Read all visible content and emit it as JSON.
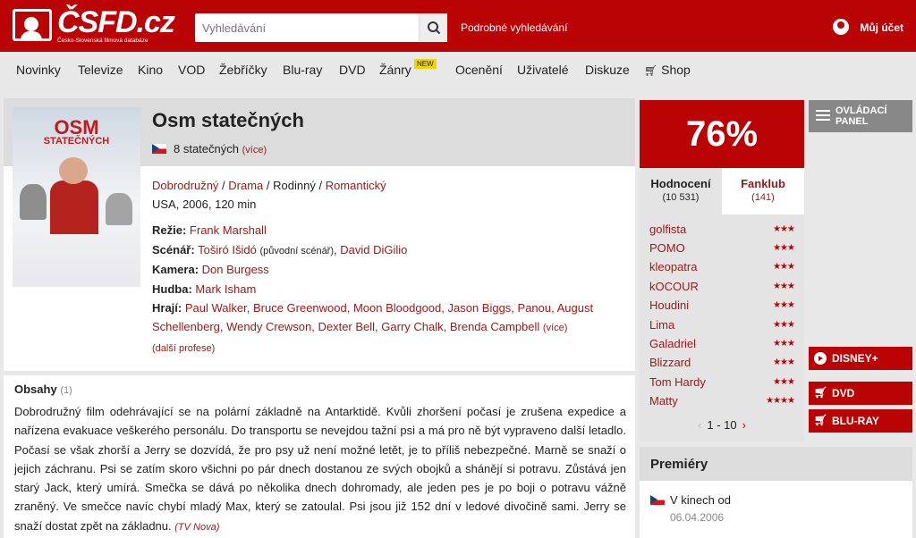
{
  "header": {
    "logo_text": "ČSFD.cz",
    "logo_tagline": "Česko-Slovenská filmová databáze",
    "search_placeholder": "Vyhledávání",
    "advanced_search": "Podrobné vyhledávání",
    "account": "Můj účet"
  },
  "nav": {
    "items": [
      "Novinky",
      "Televize",
      "Kino",
      "VOD",
      "Žebříčky",
      "Blu-ray",
      "DVD",
      "Žánry",
      "Ocenění",
      "Uživatelé",
      "Diskuze",
      "Shop"
    ],
    "new_badge": "NEW"
  },
  "film": {
    "title": "Osm statečných",
    "aka": "8 statečných",
    "aka_more": "(více)",
    "poster_title": "OSM",
    "poster_title2": "STATEČNÝCH",
    "genres": [
      "Dobrodružný",
      "Drama",
      "Rodinný",
      "Romantický"
    ],
    "origin": "USA, 2006, 120 min",
    "direction_label": "Režie:",
    "direction": "Frank Marshall",
    "screenplay_label": "Scénář:",
    "screenplay1": "Toširó Išidó",
    "screenplay_note": "(původní scénář)",
    "screenplay2": "David DiGilio",
    "camera_label": "Kamera:",
    "camera": "Don Burgess",
    "music_label": "Hudba:",
    "music": "Mark Isham",
    "cast_label": "Hrají:",
    "cast_line1": "Paul Walker, Bruce Greenwood, Moon Bloodgood, Jason Biggs, Panou, August",
    "cast_line2": "Schellenberg, Wendy Crewson, Dexter Bell, Garry Chalk, Brenda Campbell",
    "cast_more": "(více)",
    "more_profession": "(další profese)"
  },
  "plot": {
    "heading": "Obsahy",
    "count": "(1)",
    "text": "Dobrodružný film odehrávající se na polární základně na Antarktidě. Kvůli zhoršení počasí je zrušena expedice a nařízena evakuace veškerého personálu. Do transportu se nevejdou tažní psi a má pro ně být vypraveno další letadlo. Počasí se však zhorší a Jerry se dozvídá, že pro psy už není možné letět, je to příliš nebezpečné. Marně se snaží o jejich záchranu. Psi se zatím skoro všichni po pár dnech dostanou ze svých obojků a shánějí si potravu. Zůstává jen starý Jack, který umírá. Smečka se dává po několika dnech dohromady, ale jeden pes je po boji o potravu vážně zraněný. Ve smečce navíc chybí mladý Max, který se zatoulal. Psi jsou již 152 dní v ledové divočině sami. Jerry se snaží dostat zpět na základnu.",
    "source": "(TV Nova)"
  },
  "rating": {
    "percent": "76%",
    "tab_ratings": "Hodnocení",
    "tab_ratings_count": "(10 531)",
    "tab_fanclub": "Fanklub",
    "tab_fanclub_count": "(141)",
    "users": [
      {
        "name": "golfista",
        "stars": "★★★"
      },
      {
        "name": "POMO",
        "stars": "★★★"
      },
      {
        "name": "kleopatra",
        "stars": "★★★"
      },
      {
        "name": "kOCOUR",
        "stars": "★★★"
      },
      {
        "name": "Houdini",
        "stars": "★★★"
      },
      {
        "name": "Lima",
        "stars": "★★★"
      },
      {
        "name": "Galadriel",
        "stars": "★★★"
      },
      {
        "name": "Blizzard",
        "stars": "★★★"
      },
      {
        "name": "Tom Hardy",
        "stars": "★★★"
      },
      {
        "name": "Matty",
        "stars": "★★★★"
      }
    ],
    "pager": "1 - 10"
  },
  "side": {
    "control_panel": "OVLÁDACÍ PANEL",
    "disney": "DISNEY+",
    "dvd": "DVD",
    "bluray": "BLU-RAY"
  },
  "premieres": {
    "heading": "Premiéry",
    "label": "V kinech od",
    "date": "06.04.2006"
  }
}
